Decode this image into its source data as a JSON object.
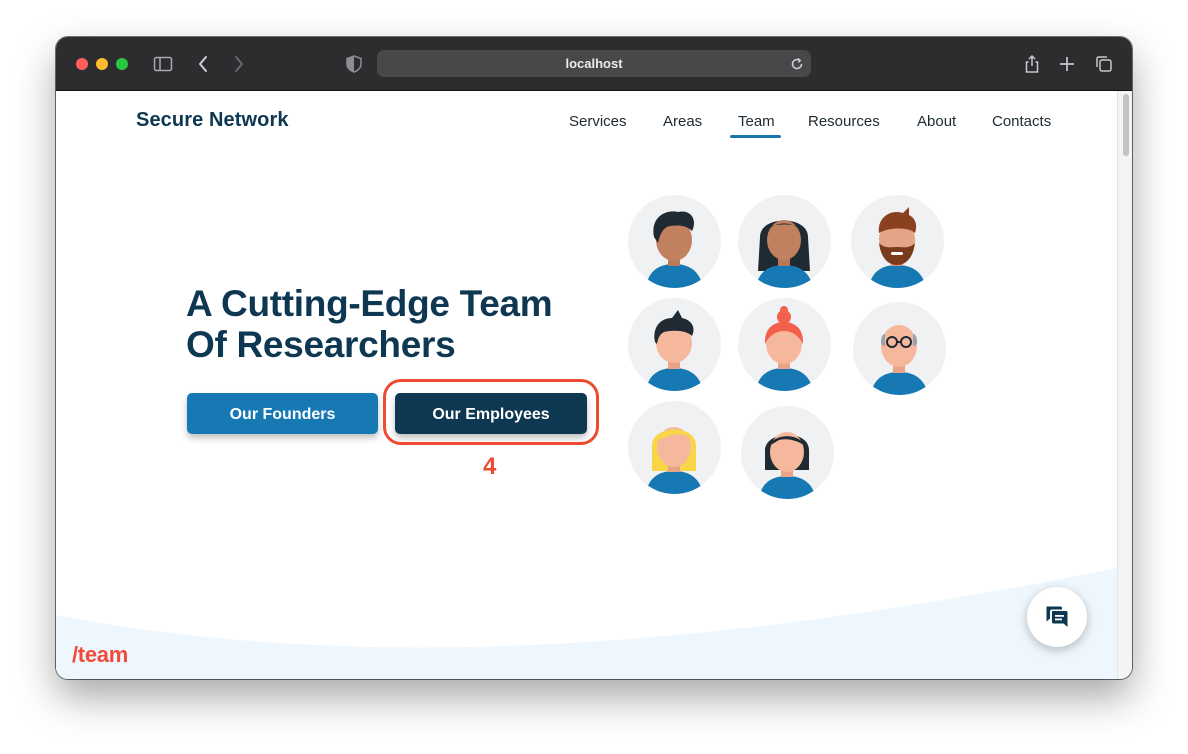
{
  "browser": {
    "url": "localhost",
    "traffic_lights": {
      "close": "#ff5f57",
      "minimize": "#febc2e",
      "zoom": "#28c840"
    },
    "icons": [
      "sidebar-icon",
      "back-icon",
      "forward-icon",
      "shield-icon",
      "reload-icon",
      "share-icon",
      "new-tab-icon",
      "tabs-overview-icon"
    ]
  },
  "site": {
    "brand": "Secure Network",
    "nav": [
      {
        "label": "Services"
      },
      {
        "label": "Areas"
      },
      {
        "label": "Team",
        "active": true
      },
      {
        "label": "Resources"
      },
      {
        "label": "About"
      },
      {
        "label": "Contacts"
      }
    ]
  },
  "hero": {
    "headline_line1": "A Cutting-Edge Team",
    "headline_line2": "Of Researchers",
    "founders_button": "Our Founders",
    "employees_button": "Our Employees"
  },
  "annotation": {
    "label": "4",
    "color": "#ef4a32"
  },
  "footer": {
    "slug": "/team"
  },
  "colors": {
    "navy": "#0e3752",
    "blue": "#1779b4",
    "accent_red": "#f14a3b",
    "wave": "#eef7fd"
  },
  "chat": {
    "icon": "chat-bubbles-icon"
  }
}
